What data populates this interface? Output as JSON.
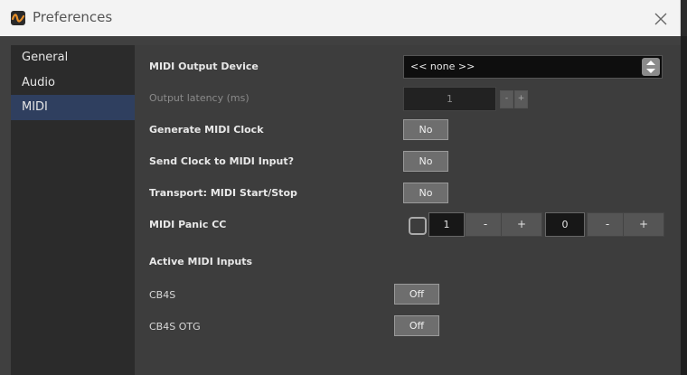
{
  "window": {
    "title": "Preferences"
  },
  "sidebar": {
    "items": [
      {
        "label": "General"
      },
      {
        "label": "Audio"
      },
      {
        "label": "MIDI",
        "active": true
      }
    ]
  },
  "midi": {
    "output_device": {
      "label": "MIDI Output Device",
      "value": "<< none >>"
    },
    "output_latency": {
      "label": "Output latency (ms)",
      "value": "1",
      "minus": "-",
      "plus": "+"
    },
    "generate_clock": {
      "label": "Generate MIDI Clock",
      "value": "No"
    },
    "send_clock": {
      "label": "Send Clock to MIDI Input?",
      "value": "No"
    },
    "transport": {
      "label": "Transport: MIDI Start/Stop",
      "value": "No"
    },
    "panic_cc": {
      "label": "MIDI Panic CC",
      "checked": false,
      "channel": "1",
      "cc": "0",
      "minus": "-",
      "plus": "+"
    },
    "active_inputs_header": "Active MIDI Inputs",
    "inputs": [
      {
        "name": "CB4S",
        "state": "Off"
      },
      {
        "name": "CB4S OTG",
        "state": "Off"
      }
    ]
  },
  "colors": {
    "active_sidebar": "#2f3f5f",
    "app_icon_accent": "#e8902a"
  },
  "icons": [
    "app-logo-icon",
    "close-icon",
    "updown-arrows-icon"
  ]
}
